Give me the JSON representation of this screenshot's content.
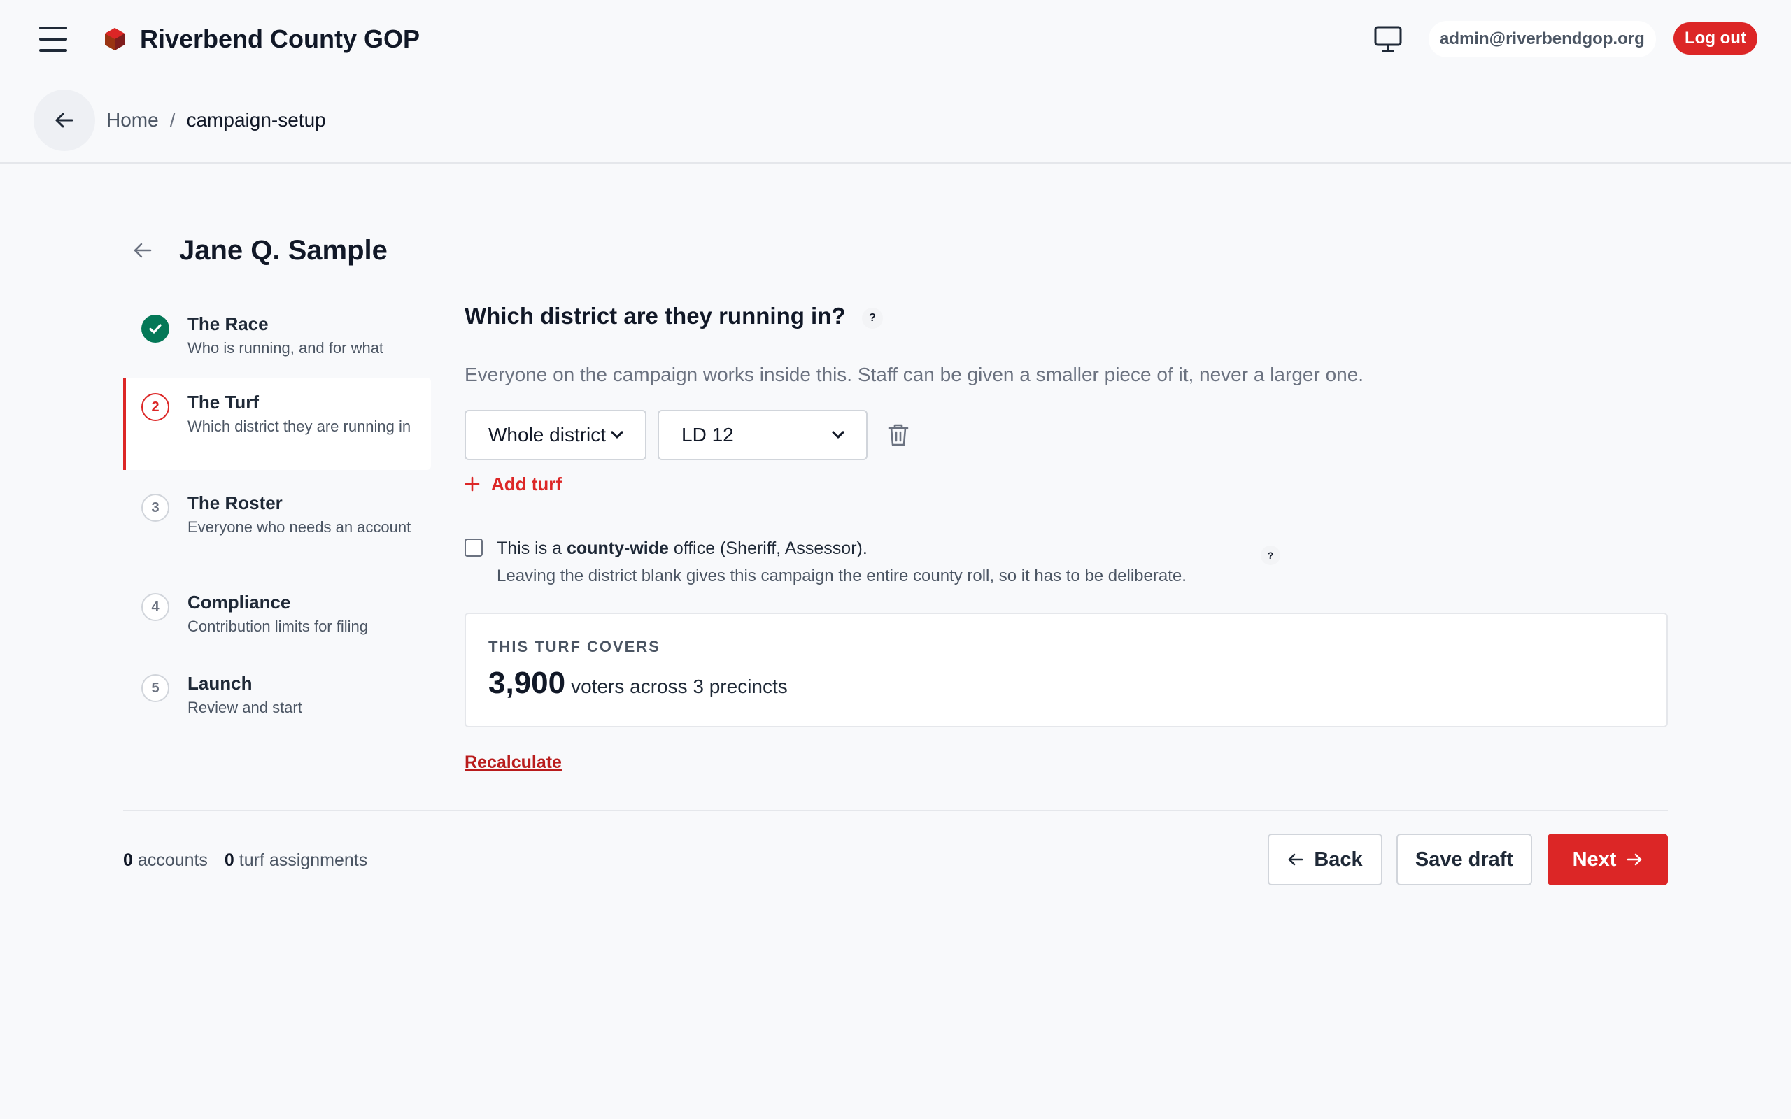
{
  "header": {
    "brand_name": "Riverbend County GOP",
    "brand_color": "#9a3412",
    "user_email": "admin@riverbendgop.org",
    "logout_label": "Log out",
    "icons": {
      "menu": "hamburger-icon",
      "display": "monitor-icon"
    }
  },
  "breadcrumb": {
    "home": "Home",
    "separator": "/",
    "current": "campaign-setup"
  },
  "page": {
    "title": "Jane Q. Sample"
  },
  "steps": [
    {
      "number": "1",
      "title": "The Race",
      "subtitle": "Who is running, and for what",
      "state": "done"
    },
    {
      "number": "2",
      "title": "The Turf",
      "subtitle": "Which district they are running in",
      "state": "current"
    },
    {
      "number": "3",
      "title": "The Roster",
      "subtitle": "Everyone who needs an account",
      "state": "pending"
    },
    {
      "number": "4",
      "title": "Compliance",
      "subtitle": "Contribution limits for filing",
      "state": "pending"
    },
    {
      "number": "5",
      "title": "Launch",
      "subtitle": "Review and start",
      "state": "pending"
    }
  ],
  "turf": {
    "question": "Which district are they running in?",
    "help_glyph": "?",
    "description": "Everyone on the campaign works inside this. Staff can be given a smaller piece of it, never a larger one.",
    "scope_select": {
      "value": "Whole district"
    },
    "district_select": {
      "value": "LD 12"
    },
    "add_turf_label": "Add turf",
    "countywide": {
      "checked": false,
      "label_pre": "This is a ",
      "label_bold": "county-wide",
      "label_post": " office (Sheriff, Assessor).",
      "note": "Leaving the district blank gives this campaign the entire county roll, so it has to be deliberate."
    },
    "covers": {
      "label": "THIS TURF COVERS",
      "voters": "3,900",
      "detail": "voters across 3 precincts"
    },
    "recalculate_label": "Recalculate"
  },
  "footer": {
    "accounts_count": "0",
    "accounts_label": "accounts",
    "turf_count": "0",
    "turf_label": "turf assignments",
    "back_label": "Back",
    "save_label": "Save draft",
    "next_label": "Next"
  },
  "colors": {
    "accent": "#dc2626",
    "success": "#047857",
    "background": "#f8f9fb"
  }
}
